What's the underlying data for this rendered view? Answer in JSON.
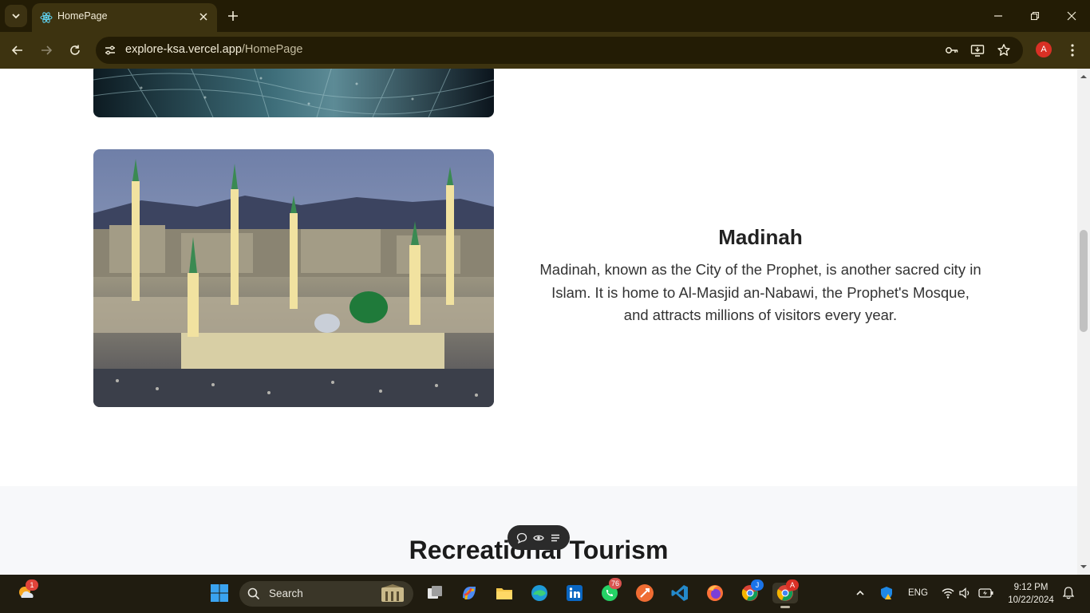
{
  "browser": {
    "tab": {
      "title": "HomePage"
    },
    "url": {
      "domain": "explore-ksa.vercel.app",
      "path": "/HomePage"
    },
    "profile_initial": "A",
    "theme_color": "#3d3310"
  },
  "page": {
    "city": {
      "title": "Madinah",
      "description": "Madinah, known as the City of the Prophet, is another sacred city in Islam. It is home to Al-Masjid an-Nabawi, the Prophet's Mosque, and attracts millions of visitors every year."
    },
    "next_section": {
      "heading": "Recreational Tourism"
    }
  },
  "floating_toolbar": {
    "icons": [
      "comment-icon",
      "eye-icon",
      "list-icon"
    ]
  },
  "taskbar": {
    "search_label": "Search",
    "widgets_badge": "1",
    "whatsapp_badge": "76",
    "chrome_profile_badge_1": "J",
    "chrome_profile_badge_2": "A",
    "language": "ENG",
    "time": "9:12 PM",
    "date": "10/22/2024"
  }
}
